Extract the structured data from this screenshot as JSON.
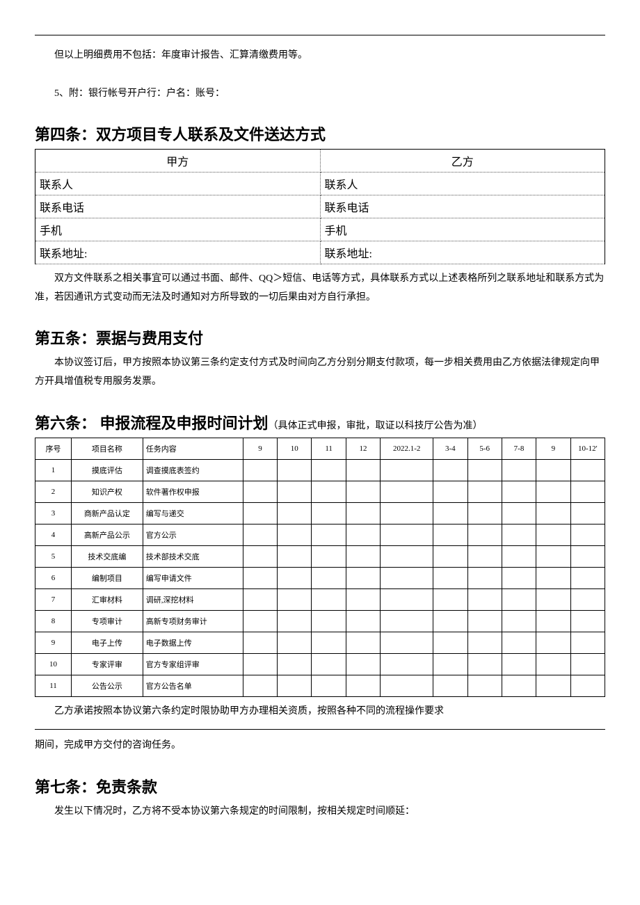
{
  "pre_note": "但以上明细费用不包括：年度审计报告、汇算清缴费用等。",
  "attach_note": "5、附：银行帐号开户行：户名：账号：",
  "section4": {
    "title": "第四条：双方项目专人联系及文件送达方式",
    "party_a_header": "甲方",
    "party_b_header": "乙方",
    "rows": [
      {
        "a": "联系人",
        "b": "联系人"
      },
      {
        "a": "联系电话",
        "b": "联系电话"
      },
      {
        "a": "手机",
        "b": "手机"
      },
      {
        "a": "联系地址:",
        "b": "联系地址:"
      }
    ],
    "note": "双方文件联系之相关事宜可以通过书面、邮件、QQ＞短信、电话等方式，具体联系方式以上述表格所列之联系地址和联系方式为准，若因通讯方式变动而无法及时通知对方所导致的一切后果由对方自行承担。"
  },
  "section5": {
    "title": "第五条：票据与费用支付",
    "body": "本协议签订后，甲方按照本协议第三条约定支付方式及时间向乙方分别分期支付款项，每一步相关费用由乙方依据法律规定向甲方开具增值税专用服务发票。"
  },
  "section6": {
    "title": "第六条： 申报流程及申报时间计划",
    "subtitle": "（具体正式申报，审批，取证以科技厅公告为准）",
    "headers": {
      "no": "序号",
      "name": "项目名称",
      "task": "任务内容",
      "m9": "9",
      "m10": "10",
      "m11": "11",
      "m12": "12",
      "m2201_02": "2022.1-2",
      "m34": "3-4",
      "m56": "5-6",
      "m78": "7-8",
      "m9b": "9",
      "m1012": "10-12'"
    },
    "rows": [
      {
        "no": "1",
        "name": "摸底评估",
        "task": "调查摸底表签约"
      },
      {
        "no": "2",
        "name": "知识产权",
        "task": "软件著作权申报"
      },
      {
        "no": "3",
        "name": "商新产品认定",
        "task": "编写与递交"
      },
      {
        "no": "4",
        "name": "高新产品公示",
        "task": "官方公示"
      },
      {
        "no": "5",
        "name": "技术交底编",
        "task": "技术部技术交底"
      },
      {
        "no": "6",
        "name": "编制项目",
        "task": "编写申请文件"
      },
      {
        "no": "7",
        "name": "汇审材料",
        "task": "调研,深挖材料"
      },
      {
        "no": "8",
        "name": "专项审计",
        "task": "高新专项财务审计"
      },
      {
        "no": "9",
        "name": "电子上传",
        "task": "电子数据上传"
      },
      {
        "no": "10",
        "name": "专家评审",
        "task": "官方专家组评审"
      },
      {
        "no": "11",
        "name": "公告公示",
        "task": "官方公告名单"
      }
    ],
    "footnote": "乙方承诺按照本协议第六条约定时限协助甲方办理相关资质，按照各种不同的流程操作要求",
    "footnote2": "期间，完成甲方交付的咨询任务。"
  },
  "section7": {
    "title": "第七条：免责条款",
    "body": "发生以下情况时，乙方将不受本协议第六条规定的时间限制，按相关规定时间顺延："
  }
}
